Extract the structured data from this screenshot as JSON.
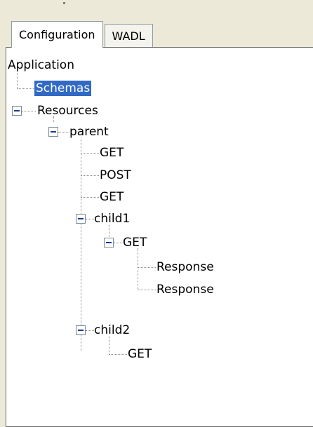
{
  "tabs": [
    {
      "label": "Configuration",
      "active": true
    },
    {
      "label": "WADL",
      "active": false
    }
  ],
  "tree": {
    "root": "Application",
    "nodes": {
      "schemas": {
        "label": "Schemas",
        "selected": true
      },
      "resources": {
        "label": "Resources",
        "expanded": true
      },
      "parent": {
        "label": "parent",
        "expanded": true
      },
      "parent_get1": {
        "label": "GET"
      },
      "parent_post": {
        "label": "POST"
      },
      "parent_get2": {
        "label": "GET"
      },
      "child1": {
        "label": "child1",
        "expanded": true
      },
      "child1_get": {
        "label": "GET",
        "expanded": true
      },
      "response1": {
        "label": "Response"
      },
      "response2": {
        "label": "Response"
      },
      "child2": {
        "label": "child2",
        "expanded": true
      },
      "child2_get": {
        "label": "GET"
      }
    }
  },
  "colors": {
    "selection": "#316ac5",
    "tree_lines": "#8a8a8a",
    "background": "#ece9d8"
  }
}
